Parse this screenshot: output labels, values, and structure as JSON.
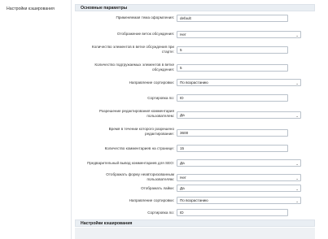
{
  "sidebar": {
    "item_label": "Настройки кэширования"
  },
  "sections": {
    "main_title": "Основные параметры",
    "cache_title": "Настройки кэширования"
  },
  "rows": [
    {
      "label": "Применяемая тема оформления:",
      "type": "input",
      "value": "default"
    },
    {
      "label": "Отображение веток обсуждения:",
      "type": "select",
      "value": "Нет"
    },
    {
      "label": "Количество элементов в ветке обсуждения при старте:",
      "type": "input",
      "value": "5"
    },
    {
      "label": "Количество подгружаемых элементов в ветке обсуждения:",
      "type": "input",
      "value": "5"
    },
    {
      "label": "Направление сортировки:",
      "type": "select",
      "value": "По возрастанию"
    },
    {
      "label": "Сортировка по:",
      "type": "input",
      "value": "ID"
    },
    {
      "label": "Разрешение редактирования комментария пользователем:",
      "type": "select",
      "value": "Да"
    },
    {
      "label": "Время в течении которого разрешено редактирование:",
      "type": "input",
      "value": "3600"
    },
    {
      "label": "Количество комментариев на странице:",
      "type": "input",
      "value": "15"
    },
    {
      "label": "Предварительный вывод комментариев для SEO:",
      "type": "select",
      "value": "Да"
    },
    {
      "label": "Отображать форму неавторизованным пользователям:",
      "type": "select",
      "value": "Нет"
    },
    {
      "label": "Отображать лайки:",
      "type": "select",
      "value": "Да"
    },
    {
      "label": "Направление сортировки:",
      "type": "select",
      "value": "По возрастанию"
    },
    {
      "label": "Сортировка по:",
      "type": "input",
      "value": "ID"
    }
  ]
}
